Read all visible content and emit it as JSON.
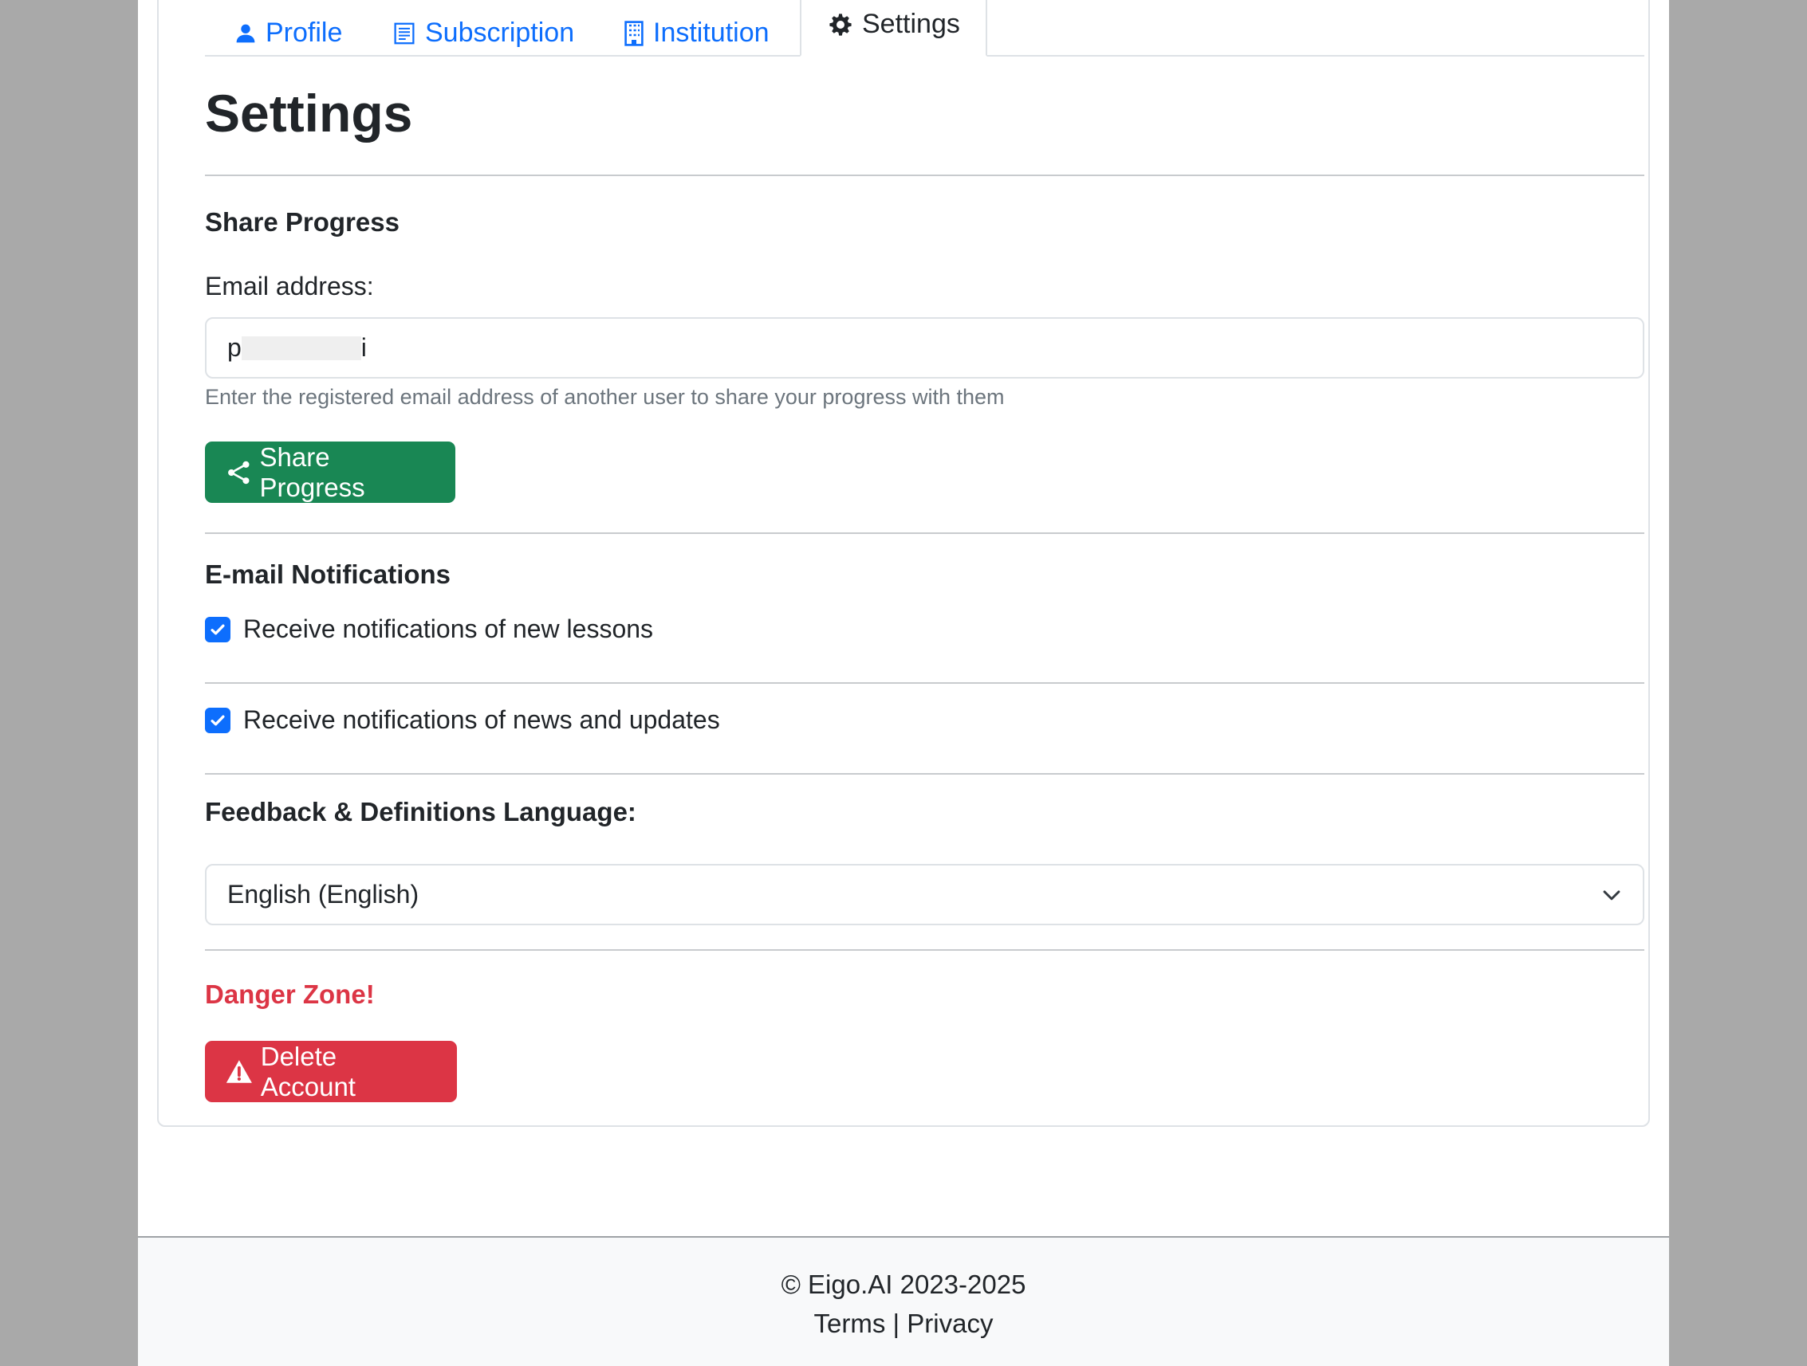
{
  "tabs": [
    {
      "label": "Profile",
      "icon": "person-icon"
    },
    {
      "label": "Subscription",
      "icon": "receipt-icon"
    },
    {
      "label": "Institution",
      "icon": "building-icon"
    },
    {
      "label": "Settings",
      "icon": "gear-icon"
    }
  ],
  "page_title": "Settings",
  "share": {
    "heading": "Share Progress",
    "email_label": "Email address:",
    "email_value_start": "p",
    "email_value_end": "i",
    "help_text": "Enter the registered email address of another user to share your progress with them",
    "button_label": "Share Progress"
  },
  "notifications": {
    "heading": "E-mail Notifications",
    "items": [
      {
        "label": "Receive notifications of new lessons",
        "checked": true
      },
      {
        "label": "Receive notifications of news and updates",
        "checked": true
      }
    ]
  },
  "language": {
    "heading": "Feedback & Definitions Language:",
    "selected": "English (English)"
  },
  "danger": {
    "heading": "Danger Zone!",
    "button_label": "Delete Account"
  },
  "footer": {
    "copyright": "© Eigo.AI 2023-2025",
    "terms": "Terms",
    "separator": "|",
    "privacy": "Privacy"
  },
  "colors": {
    "primary": "#0d6efd",
    "success": "#198754",
    "danger": "#dc3545"
  }
}
